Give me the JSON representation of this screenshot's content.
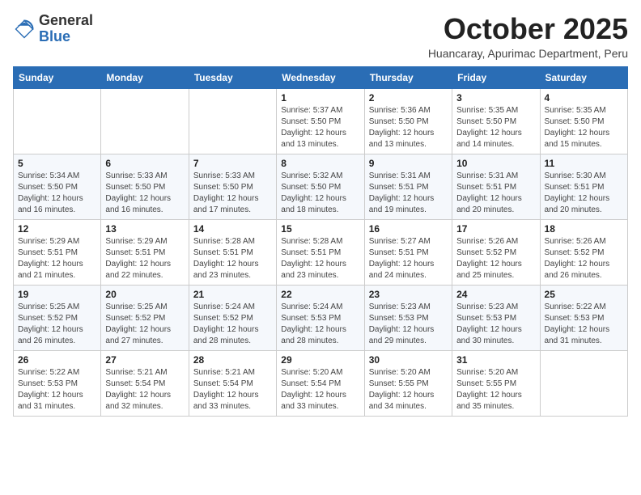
{
  "header": {
    "logo_general": "General",
    "logo_blue": "Blue",
    "month_title": "October 2025",
    "subtitle": "Huancaray, Apurimac Department, Peru"
  },
  "days_of_week": [
    "Sunday",
    "Monday",
    "Tuesday",
    "Wednesday",
    "Thursday",
    "Friday",
    "Saturday"
  ],
  "weeks": [
    [
      {
        "day": "",
        "info": ""
      },
      {
        "day": "",
        "info": ""
      },
      {
        "day": "",
        "info": ""
      },
      {
        "day": "1",
        "info": "Sunrise: 5:37 AM\nSunset: 5:50 PM\nDaylight: 12 hours\nand 13 minutes."
      },
      {
        "day": "2",
        "info": "Sunrise: 5:36 AM\nSunset: 5:50 PM\nDaylight: 12 hours\nand 13 minutes."
      },
      {
        "day": "3",
        "info": "Sunrise: 5:35 AM\nSunset: 5:50 PM\nDaylight: 12 hours\nand 14 minutes."
      },
      {
        "day": "4",
        "info": "Sunrise: 5:35 AM\nSunset: 5:50 PM\nDaylight: 12 hours\nand 15 minutes."
      }
    ],
    [
      {
        "day": "5",
        "info": "Sunrise: 5:34 AM\nSunset: 5:50 PM\nDaylight: 12 hours\nand 16 minutes."
      },
      {
        "day": "6",
        "info": "Sunrise: 5:33 AM\nSunset: 5:50 PM\nDaylight: 12 hours\nand 16 minutes."
      },
      {
        "day": "7",
        "info": "Sunrise: 5:33 AM\nSunset: 5:50 PM\nDaylight: 12 hours\nand 17 minutes."
      },
      {
        "day": "8",
        "info": "Sunrise: 5:32 AM\nSunset: 5:50 PM\nDaylight: 12 hours\nand 18 minutes."
      },
      {
        "day": "9",
        "info": "Sunrise: 5:31 AM\nSunset: 5:51 PM\nDaylight: 12 hours\nand 19 minutes."
      },
      {
        "day": "10",
        "info": "Sunrise: 5:31 AM\nSunset: 5:51 PM\nDaylight: 12 hours\nand 20 minutes."
      },
      {
        "day": "11",
        "info": "Sunrise: 5:30 AM\nSunset: 5:51 PM\nDaylight: 12 hours\nand 20 minutes."
      }
    ],
    [
      {
        "day": "12",
        "info": "Sunrise: 5:29 AM\nSunset: 5:51 PM\nDaylight: 12 hours\nand 21 minutes."
      },
      {
        "day": "13",
        "info": "Sunrise: 5:29 AM\nSunset: 5:51 PM\nDaylight: 12 hours\nand 22 minutes."
      },
      {
        "day": "14",
        "info": "Sunrise: 5:28 AM\nSunset: 5:51 PM\nDaylight: 12 hours\nand 23 minutes."
      },
      {
        "day": "15",
        "info": "Sunrise: 5:28 AM\nSunset: 5:51 PM\nDaylight: 12 hours\nand 23 minutes."
      },
      {
        "day": "16",
        "info": "Sunrise: 5:27 AM\nSunset: 5:51 PM\nDaylight: 12 hours\nand 24 minutes."
      },
      {
        "day": "17",
        "info": "Sunrise: 5:26 AM\nSunset: 5:52 PM\nDaylight: 12 hours\nand 25 minutes."
      },
      {
        "day": "18",
        "info": "Sunrise: 5:26 AM\nSunset: 5:52 PM\nDaylight: 12 hours\nand 26 minutes."
      }
    ],
    [
      {
        "day": "19",
        "info": "Sunrise: 5:25 AM\nSunset: 5:52 PM\nDaylight: 12 hours\nand 26 minutes."
      },
      {
        "day": "20",
        "info": "Sunrise: 5:25 AM\nSunset: 5:52 PM\nDaylight: 12 hours\nand 27 minutes."
      },
      {
        "day": "21",
        "info": "Sunrise: 5:24 AM\nSunset: 5:52 PM\nDaylight: 12 hours\nand 28 minutes."
      },
      {
        "day": "22",
        "info": "Sunrise: 5:24 AM\nSunset: 5:53 PM\nDaylight: 12 hours\nand 28 minutes."
      },
      {
        "day": "23",
        "info": "Sunrise: 5:23 AM\nSunset: 5:53 PM\nDaylight: 12 hours\nand 29 minutes."
      },
      {
        "day": "24",
        "info": "Sunrise: 5:23 AM\nSunset: 5:53 PM\nDaylight: 12 hours\nand 30 minutes."
      },
      {
        "day": "25",
        "info": "Sunrise: 5:22 AM\nSunset: 5:53 PM\nDaylight: 12 hours\nand 31 minutes."
      }
    ],
    [
      {
        "day": "26",
        "info": "Sunrise: 5:22 AM\nSunset: 5:53 PM\nDaylight: 12 hours\nand 31 minutes."
      },
      {
        "day": "27",
        "info": "Sunrise: 5:21 AM\nSunset: 5:54 PM\nDaylight: 12 hours\nand 32 minutes."
      },
      {
        "day": "28",
        "info": "Sunrise: 5:21 AM\nSunset: 5:54 PM\nDaylight: 12 hours\nand 33 minutes."
      },
      {
        "day": "29",
        "info": "Sunrise: 5:20 AM\nSunset: 5:54 PM\nDaylight: 12 hours\nand 33 minutes."
      },
      {
        "day": "30",
        "info": "Sunrise: 5:20 AM\nSunset: 5:55 PM\nDaylight: 12 hours\nand 34 minutes."
      },
      {
        "day": "31",
        "info": "Sunrise: 5:20 AM\nSunset: 5:55 PM\nDaylight: 12 hours\nand 35 minutes."
      },
      {
        "day": "",
        "info": ""
      }
    ]
  ]
}
